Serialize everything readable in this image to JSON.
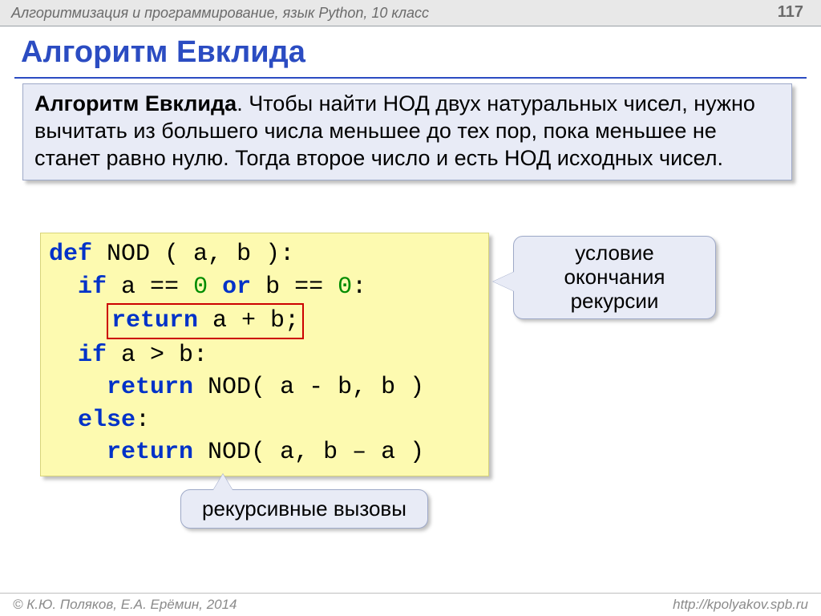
{
  "header": {
    "course": "Алгоритмизация и программирование, язык Python, 10 класс",
    "page": "117"
  },
  "title": "Алгоритм Евклида",
  "info": {
    "lead": "Алгоритм Евклида",
    "text": ". Чтобы найти НОД двух натуральных чисел, нужно вычитать из большего числа меньшее до тех пор, пока меньшее не станет равно нулю. Тогда второе число и есть НОД исходных чисел."
  },
  "code": {
    "kw_def": "def",
    "fn": "NOD",
    "args": " ( a, b ):",
    "kw_if1": "if",
    "cond1_a": " a == ",
    "zero1": "0",
    "kw_or": " or ",
    "cond1_b": "b == ",
    "zero2": "0",
    "colon": ":",
    "kw_return1": "return",
    "ret1": " a + b;",
    "kw_if2": "if",
    "cond2": " a > b:",
    "kw_return2": "return",
    "call2": " NOD( a - b, b )",
    "kw_else": "else",
    "kw_return3": "return",
    "call3": " NOD( a, b – a )"
  },
  "callouts": {
    "c1": "условие окончания рекурсии",
    "c2": "рекурсивные вызовы"
  },
  "footer": {
    "left": "© К.Ю. Поляков, Е.А. Ерёмин, 2014",
    "right": "http://kpolyakov.spb.ru"
  }
}
